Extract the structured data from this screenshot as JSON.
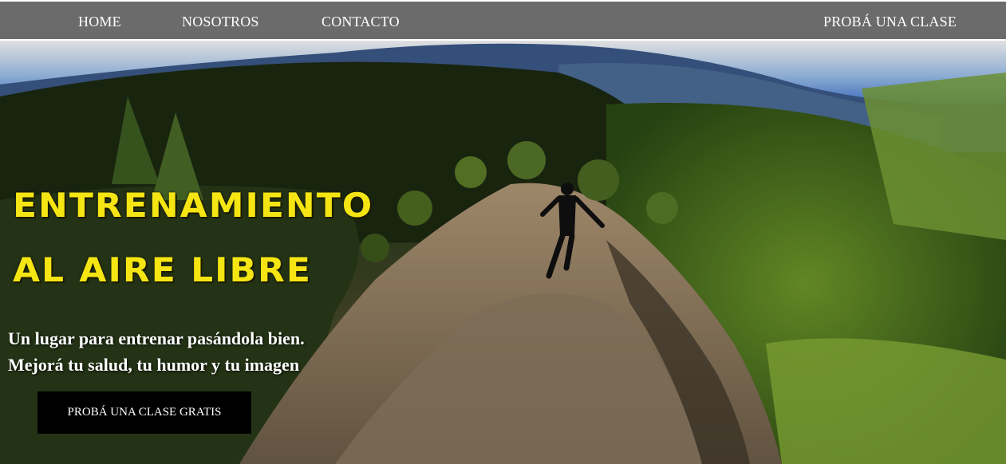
{
  "nav": {
    "home": "HOME",
    "nosotros": "NOSOTROS",
    "contacto": "CONTACTO",
    "cta": "PROBÁ UNA CLASE"
  },
  "hero": {
    "headline_line1": "ENTRENAMIENTO",
    "headline_line2": "AL AIRE LIBRE",
    "subtitle_line1": "Un lugar para entrenar pasándola bien.",
    "subtitle_line2": "Mejorá tu salud, tu humor y tu imagen",
    "button_label": "PROBÁ UNA CLASE GRATIS",
    "image_description": "Aerial view of a person running along a rocky mountain ridge surrounded by pine forest and distant blue mountains"
  },
  "colors": {
    "navbar_bg": "#6b6b6b",
    "headline": "#f5e513",
    "button_bg": "#000000",
    "text_light": "#ffffff"
  }
}
